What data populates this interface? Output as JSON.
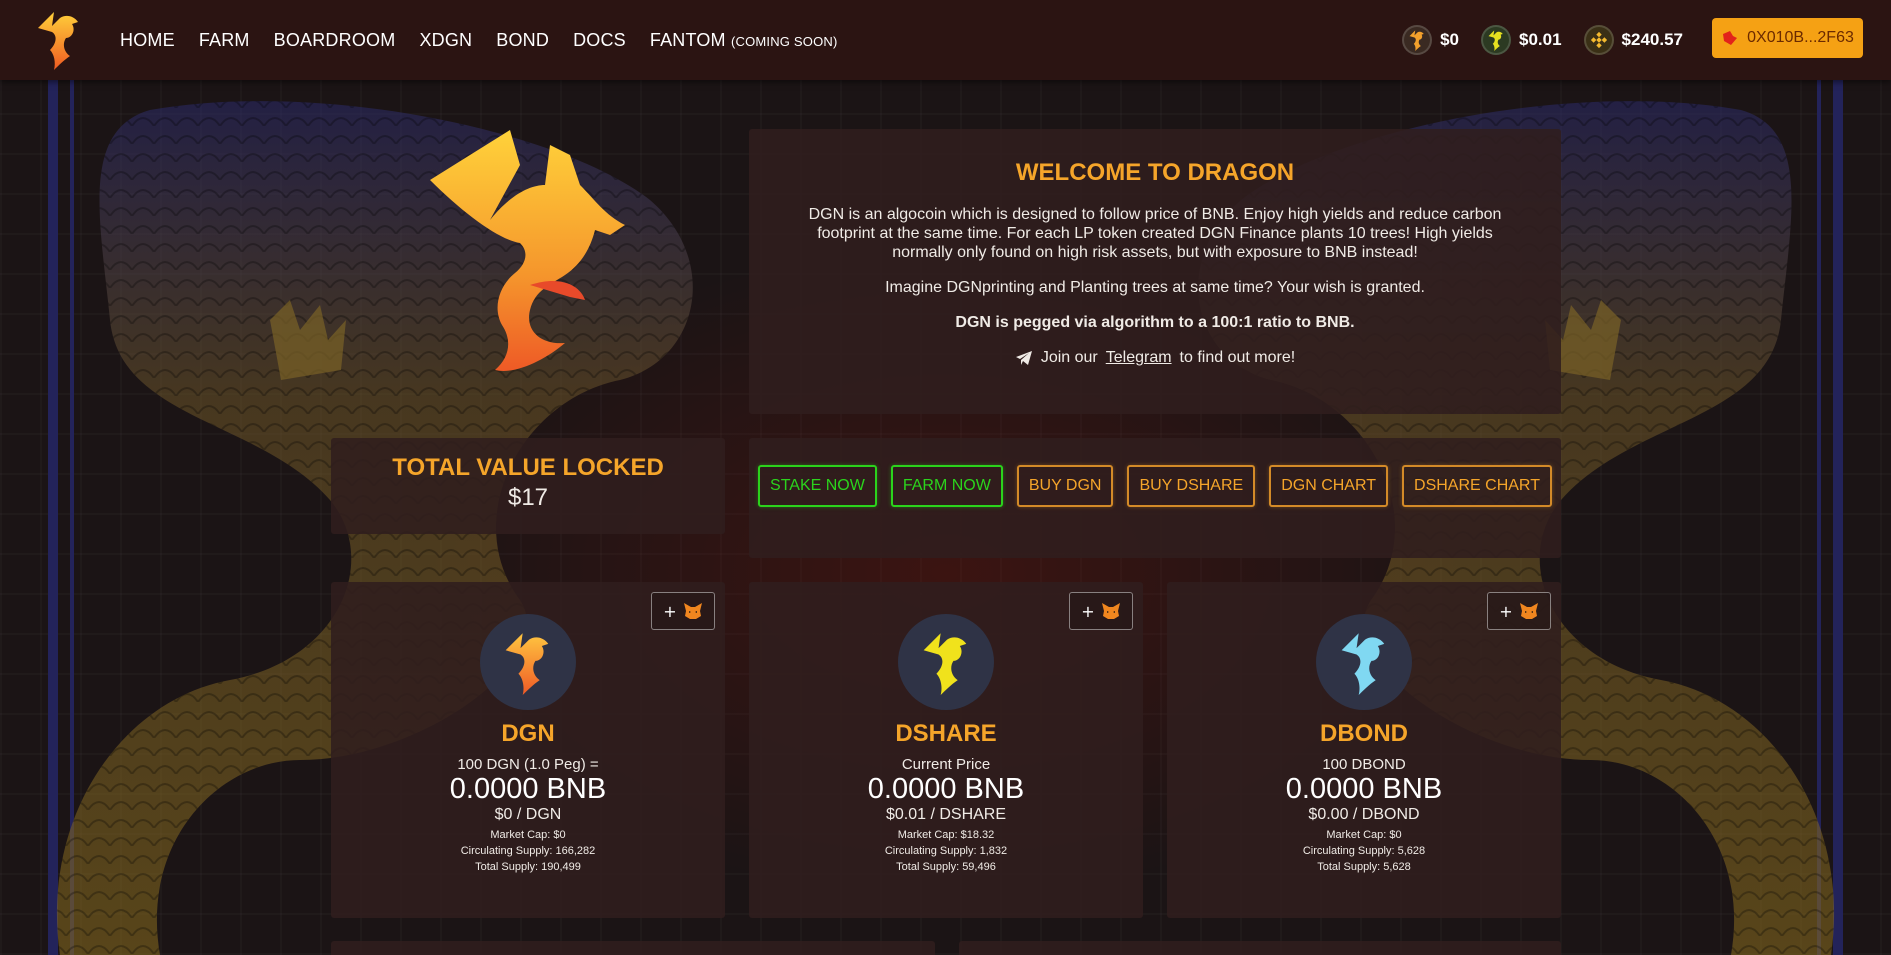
{
  "nav": {
    "links": [
      "HOME",
      "FARM",
      "BOARDROOM",
      "XDGN",
      "BOND",
      "DOCS",
      "FANTOM"
    ],
    "fantom_suffix": "(COMING SOON)",
    "prices": [
      {
        "icon": "dgn-coin-icon",
        "value": "$0"
      },
      {
        "icon": "dshare-coin-icon",
        "value": "$0.01"
      },
      {
        "icon": "bnb-coin-icon",
        "value": "$240.57"
      }
    ],
    "wallet": "0X010B...2F63",
    "colors": {
      "bar": "#2b1412",
      "wallet": "#f5a114"
    }
  },
  "welcome": {
    "title": "WELCOME TO DRAGON",
    "p1": "DGN is an algocoin which is designed to follow price of BNB. Enjoy high yields and reduce carbon footprint at the same time. For each LP token created DGN Finance plants 10 trees! High yields normally only found on high risk assets, but with exposure to BNB instead!",
    "p2": "Imagine DGNprinting and Planting trees at same time? Your wish is granted.",
    "p3": "DGN is pegged via algorithm to a 100:1 ratio to BNB.",
    "join_prefix": "Join our",
    "telegram": "Telegram",
    "join_suffix": "to find out more!"
  },
  "tvl": {
    "title": "TOTAL VALUE LOCKED",
    "value": "$17"
  },
  "actions": [
    {
      "label": "STAKE NOW",
      "style": "green"
    },
    {
      "label": "FARM NOW",
      "style": "green"
    },
    {
      "label": "BUY DGN",
      "style": "orange"
    },
    {
      "label": "BUY DSHARE",
      "style": "orange"
    },
    {
      "label": "DGN CHART",
      "style": "orange"
    },
    {
      "label": "DSHARE CHART",
      "style": "orange"
    }
  ],
  "cards": [
    {
      "name": "DGN",
      "sub": "100 DGN (1.0 Peg) =",
      "price": "0.0000 BNB",
      "unit": "$0 / DGN",
      "market_cap": "Market Cap: $0",
      "circulating": "Circulating Supply: 166,282",
      "total": "Total Supply: 190,499",
      "color": "#f08a2c"
    },
    {
      "name": "DSHARE",
      "sub": "Current Price",
      "price": "0.0000 BNB",
      "unit": "$0.01 / DSHARE",
      "market_cap": "Market Cap: $18.32",
      "circulating": "Circulating Supply: 1,832",
      "total": "Total Supply: 59,496",
      "color": "#f2e21a"
    },
    {
      "name": "DBOND",
      "sub": "100 DBOND",
      "price": "0.0000 BNB",
      "unit": "$0.00 / DBOND",
      "market_cap": "Market Cap: $0",
      "circulating": "Circulating Supply: 5,628",
      "total": "Total Supply: 5,628",
      "color": "#7fd6f2"
    }
  ],
  "metamask_plus": "+"
}
